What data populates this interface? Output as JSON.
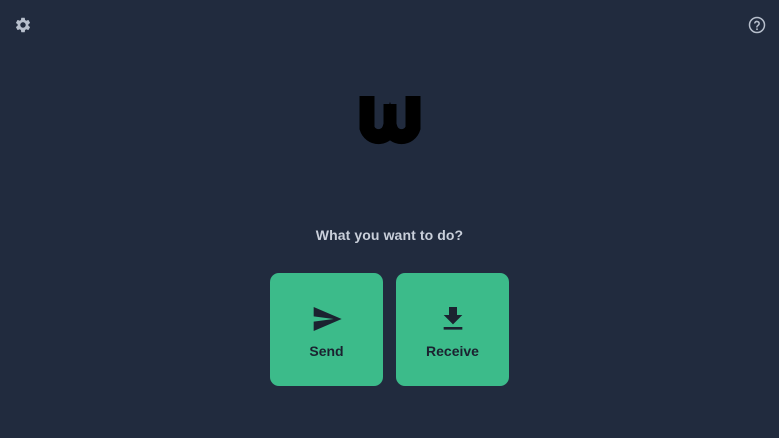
{
  "colors": {
    "background": "#212b3e",
    "accent": "#3cbb8a",
    "icon_muted": "#b7bfcc",
    "text": "#c9cfda",
    "button_text": "#1b2230"
  },
  "toolbar": {
    "settings_icon": "gear-icon",
    "help_icon": "help-circle-icon"
  },
  "logo": {
    "icon": "w-logo-icon"
  },
  "main": {
    "prompt": "What you want to do?",
    "actions": [
      {
        "label": "Send",
        "icon": "send-icon"
      },
      {
        "label": "Receive",
        "icon": "download-icon"
      }
    ]
  }
}
